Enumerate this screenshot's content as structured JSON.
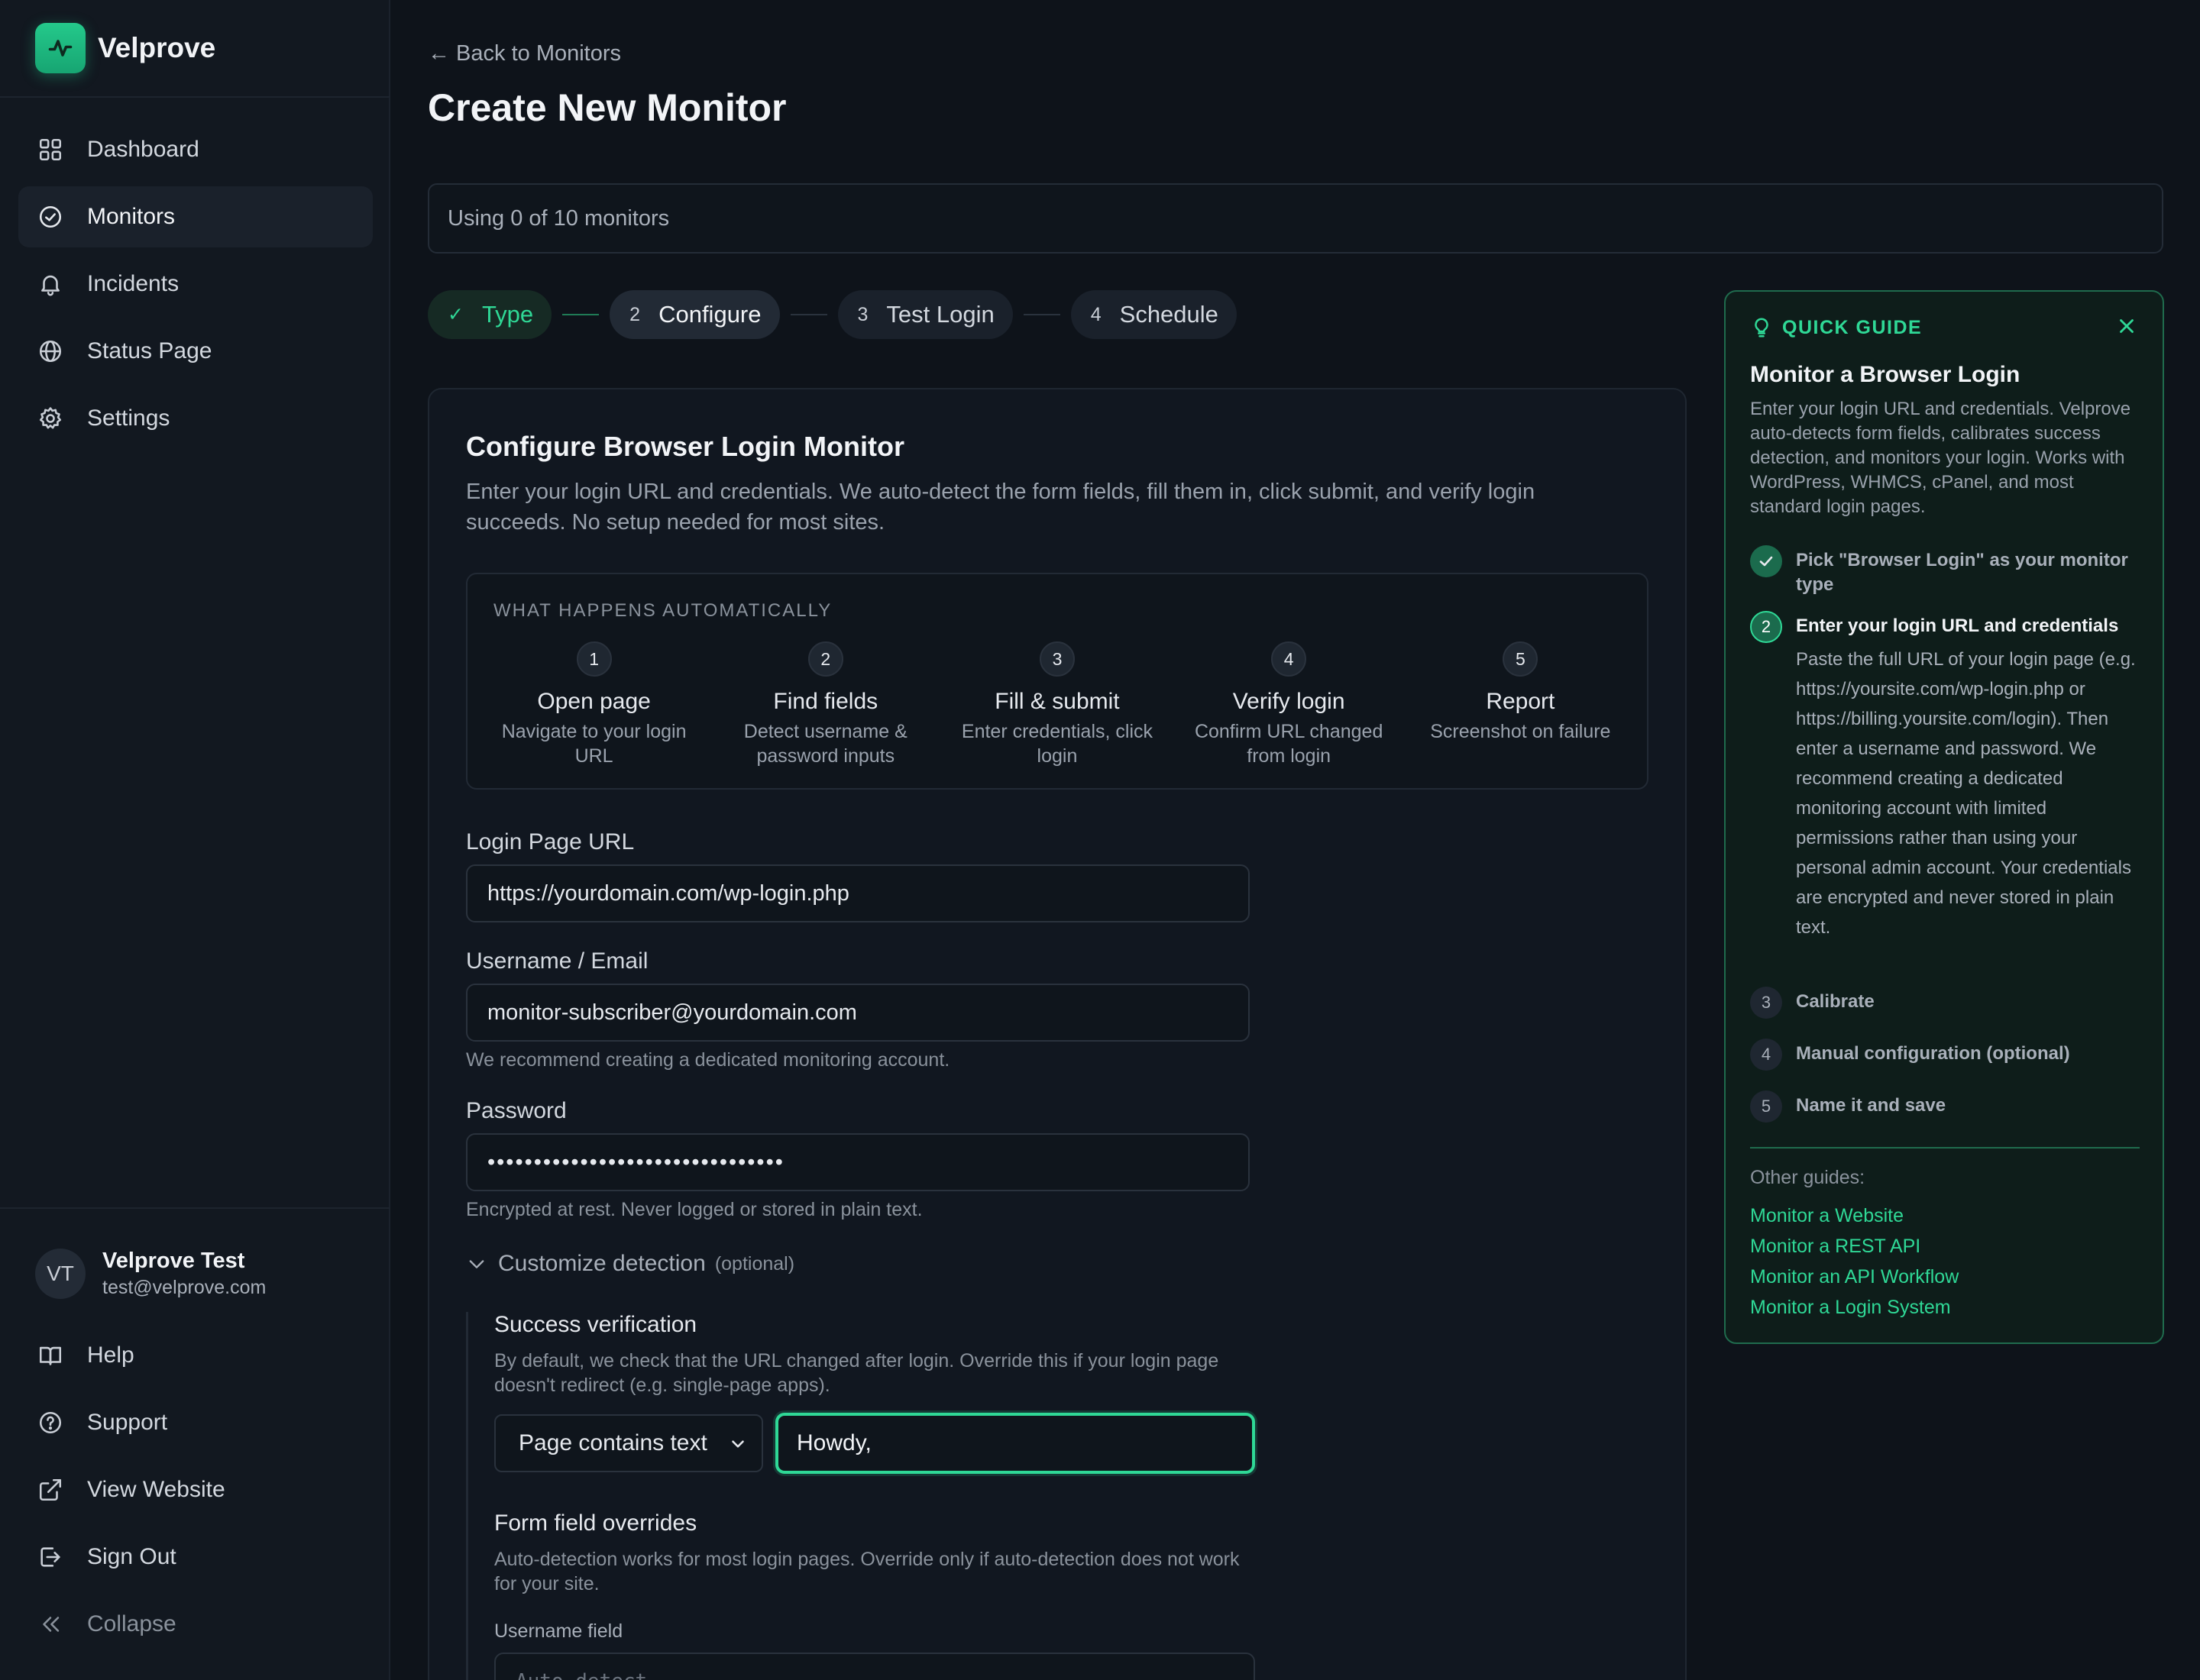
{
  "app": {
    "name": "Velprove"
  },
  "sidebar": {
    "items": [
      {
        "label": "Dashboard",
        "icon": "grid-icon"
      },
      {
        "label": "Monitors",
        "icon": "check-circle-icon",
        "active": true
      },
      {
        "label": "Incidents",
        "icon": "bell-icon"
      },
      {
        "label": "Status Page",
        "icon": "globe-icon"
      },
      {
        "label": "Settings",
        "icon": "gear-icon"
      }
    ],
    "user": {
      "initials": "VT",
      "name": "Velprove Test",
      "email": "test@velprove.com"
    },
    "bottom_items": [
      {
        "label": "Help",
        "icon": "book-icon"
      },
      {
        "label": "Support",
        "icon": "help-circle-icon"
      },
      {
        "label": "View Website",
        "icon": "external-link-icon"
      },
      {
        "label": "Sign Out",
        "icon": "sign-out-icon"
      },
      {
        "label": "Collapse",
        "icon": "chevrons-left-icon"
      }
    ]
  },
  "header": {
    "back_link": "← Back to Monitors",
    "title": "Create New Monitor",
    "usage": "Using 0 of 10 monitors"
  },
  "stepper": [
    {
      "num": "✓",
      "label": "Type",
      "state": "done"
    },
    {
      "num": "2",
      "label": "Configure",
      "state": "current"
    },
    {
      "num": "3",
      "label": "Test Login",
      "state": "pending"
    },
    {
      "num": "4",
      "label": "Schedule",
      "state": "pending"
    }
  ],
  "card": {
    "title": "Configure Browser Login Monitor",
    "description": "Enter your login URL and credentials. We auto-detect the form fields, fill them in, click submit, and verify login succeeds. No setup needed for most sites.",
    "auto_title": "WHAT HAPPENS AUTOMATICALLY",
    "auto_steps": [
      {
        "num": "1",
        "label": "Open page",
        "sub": "Navigate to your login URL"
      },
      {
        "num": "2",
        "label": "Find fields",
        "sub": "Detect username & password inputs"
      },
      {
        "num": "3",
        "label": "Fill & submit",
        "sub": "Enter credentials, click login"
      },
      {
        "num": "4",
        "label": "Verify login",
        "sub": "Confirm URL changed from login"
      },
      {
        "num": "5",
        "label": "Report",
        "sub": "Screenshot on failure"
      }
    ],
    "url_label": "Login Page URL",
    "url_value": "https://yourdomain.com/wp-login.php",
    "username_label": "Username / Email",
    "username_value": "monitor-subscriber@yourdomain.com",
    "username_help": "We recommend creating a dedicated monitoring account.",
    "password_label": "Password",
    "password_value": "••••••••••••••••••••••••••••••••",
    "password_help": "Encrypted at rest. Never logged or stored in plain text.",
    "customize_label": "Customize detection",
    "customize_optional": "(optional)",
    "success_title": "Success verification",
    "success_desc": "By default, we check that the URL changed after login. Override this if your login page doesn't redirect (e.g. single-page apps).",
    "success_select": "Page contains text",
    "success_text": "Howdy,",
    "overrides_title": "Form field overrides",
    "overrides_desc": "Auto-detection works for most login pages. Override only if auto-detection does not work for your site.",
    "username_field_label": "Username field",
    "username_field_placeholder": "Auto-detect"
  },
  "guide": {
    "head": "QUICK GUIDE",
    "title": "Monitor a Browser Login",
    "description": "Enter your login URL and credentials. Velprove auto-detects form fields, calibrates success detection, and monitors your login. Works with WordPress, WHMCS, cPanel, and most standard login pages.",
    "steps": [
      {
        "num": "✓",
        "text": "Pick \"Browser Login\" as your monitor type",
        "state": "done"
      },
      {
        "num": "2",
        "text": "Enter your login URL and credentials",
        "state": "current",
        "detail": "Paste the full URL of your login page (e.g. https://yoursite.com/wp-login.php or https://billing.yoursite.com/login). Then enter a username and password. We recommend creating a dedicated monitoring account with limited permissions rather than using your personal admin account. Your credentials are encrypted and never stored in plain text."
      },
      {
        "num": "3",
        "text": "Calibrate",
        "state": "pending"
      },
      {
        "num": "4",
        "text": "Manual configuration (optional)",
        "state": "pending"
      },
      {
        "num": "5",
        "text": "Name it and save",
        "state": "pending"
      }
    ],
    "other_label": "Other guides:",
    "links": [
      "Monitor a Website",
      "Monitor a REST API",
      "Monitor an API Workflow",
      "Monitor a Login System"
    ]
  },
  "colors": {
    "accent": "#2fd896",
    "background": "#0e131a",
    "sidebar": "#121820"
  }
}
